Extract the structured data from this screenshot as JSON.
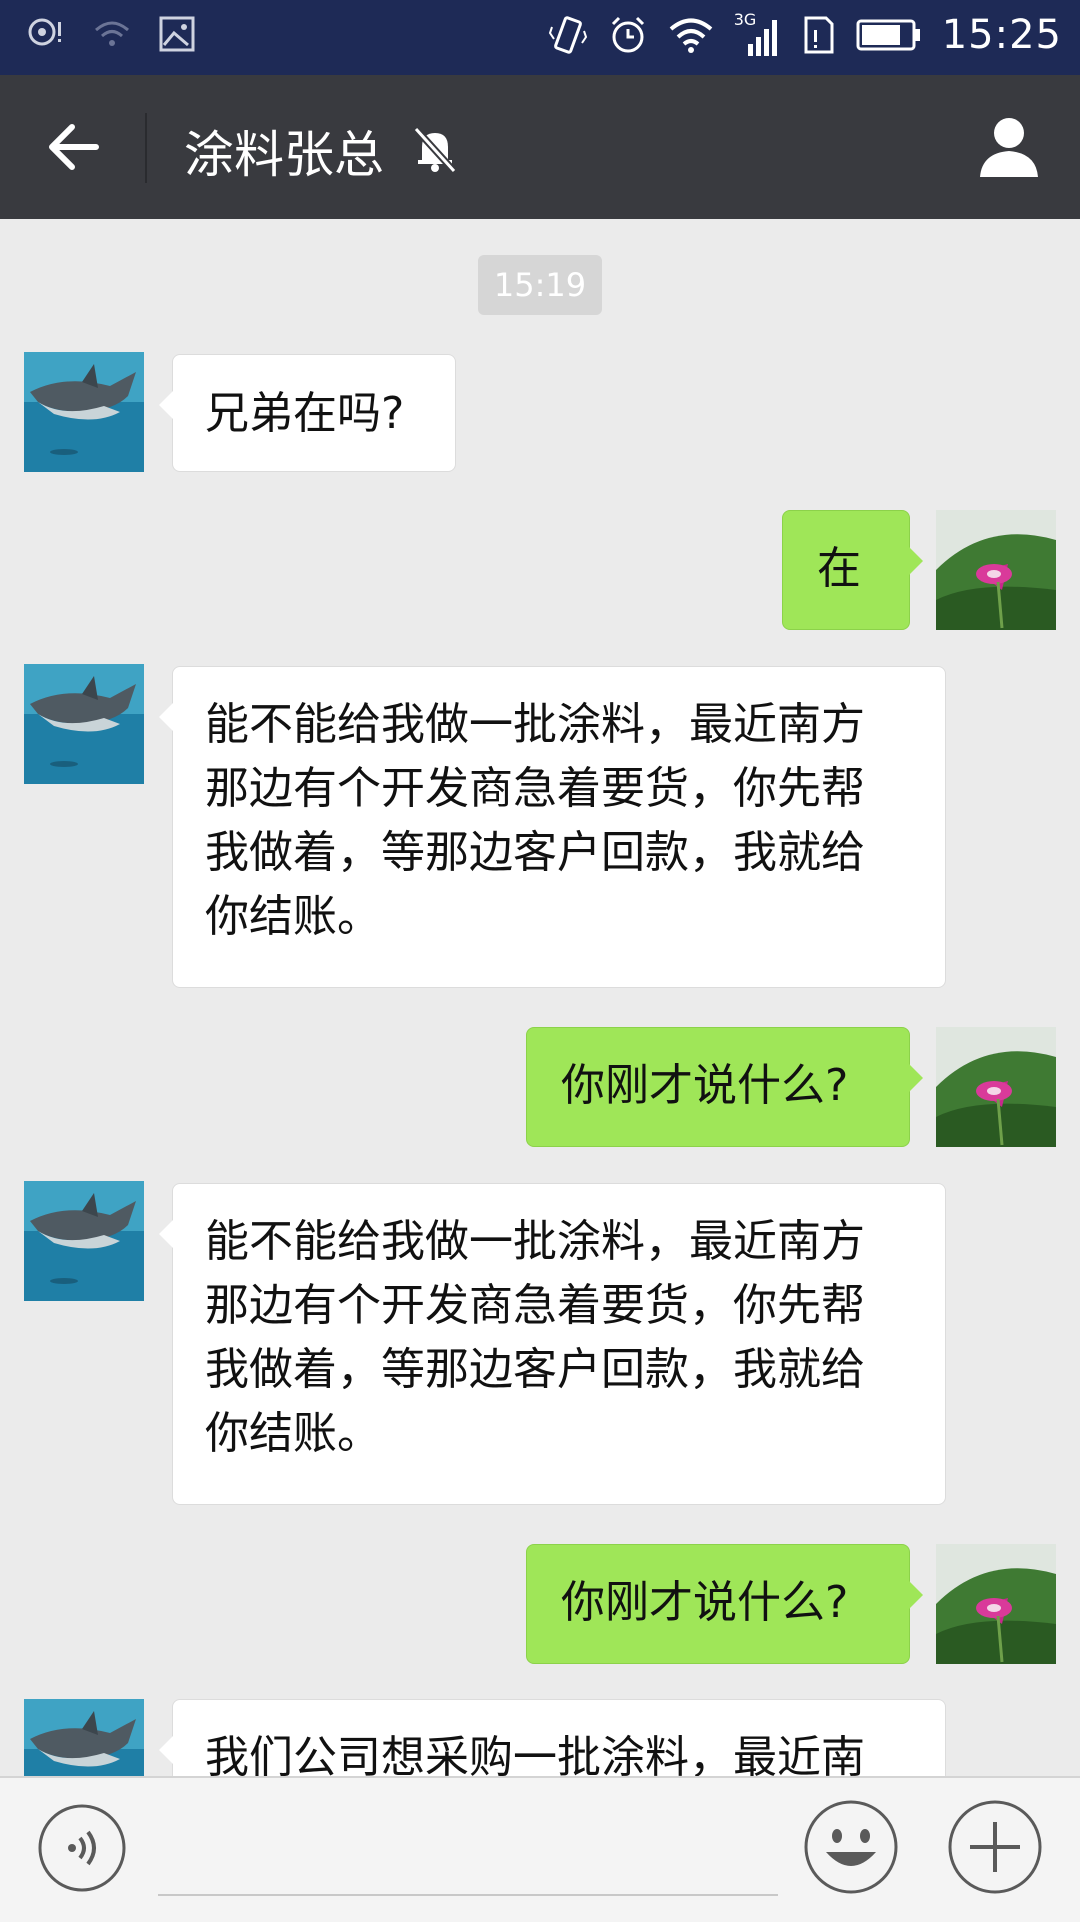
{
  "status_bar": {
    "time": "15:25",
    "network": "3G",
    "icons": [
      "notification-icon",
      "wifi-weak-icon",
      "image-icon",
      "vibrate-icon",
      "alarm-icon",
      "wifi-icon",
      "signal-icon",
      "sim-icon",
      "battery-icon"
    ]
  },
  "header": {
    "title": "涂料张总",
    "back_icon": "back-arrow-icon",
    "mute_icon": "bell-muted-icon",
    "profile_icon": "person-icon"
  },
  "chat": {
    "timestamp": "15:19",
    "messages": [
      {
        "sender": "contact",
        "text": "兄弟在吗?"
      },
      {
        "sender": "me",
        "text": "在"
      },
      {
        "sender": "contact",
        "lines": [
          "能不能给我做一批涂料，最近南方",
          "那边有个开发商急着要货，你先帮",
          "我做着，等那边客户回款，我就给",
          "你结账。"
        ]
      },
      {
        "sender": "me",
        "text": "你刚才说什么?"
      },
      {
        "sender": "contact",
        "lines": [
          "能不能给我做一批涂料，最近南方",
          "那边有个开发商急着要货，你先帮",
          "我做着，等那边客户回款，我就给",
          "你结账。"
        ]
      },
      {
        "sender": "me",
        "text": "你刚才说什么?"
      },
      {
        "sender": "contact",
        "lines": [
          "我们公司想采购一批涂料，最近南"
        ]
      }
    ]
  },
  "input_bar": {
    "voice_icon": "voice-icon",
    "emoji_icon": "emoji-icon",
    "plus_icon": "plus-icon"
  },
  "colors": {
    "status_bar": "#1e2a56",
    "title_bar": "#393a3f",
    "chat_bg": "#ebebeb",
    "my_bubble": "#9fe658",
    "their_bubble": "#ffffff"
  }
}
